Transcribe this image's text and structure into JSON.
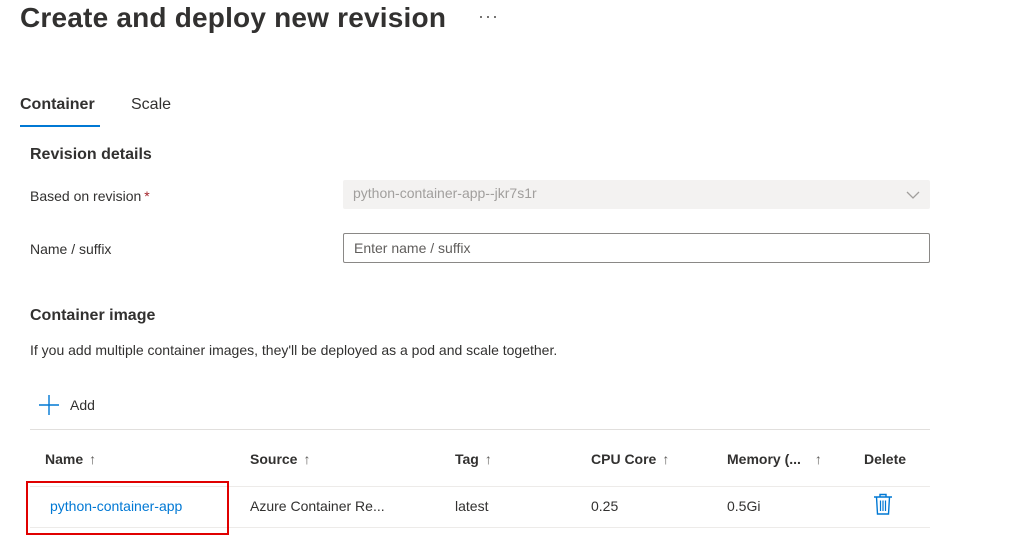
{
  "page": {
    "title": "Create and deploy new revision",
    "more_label": "···"
  },
  "tabs": [
    {
      "label": "Container",
      "selected": true
    },
    {
      "label": "Scale",
      "selected": false
    }
  ],
  "revision_details": {
    "heading": "Revision details",
    "based_on_label": "Based on revision",
    "required_marker": "*",
    "based_on_value": "python-container-app--jkr7s1r",
    "name_suffix_label": "Name / suffix",
    "name_suffix_value": "",
    "name_suffix_placeholder": "Enter name / suffix"
  },
  "container_image": {
    "heading": "Container image",
    "description": "If you add multiple container images, they'll be deployed as a pod and scale together.",
    "add_label": "Add",
    "table": {
      "columns": [
        {
          "label": "Name",
          "sort_arrow": "↑"
        },
        {
          "label": "Source",
          "sort_arrow": "↑"
        },
        {
          "label": "Tag",
          "sort_arrow": "↑"
        },
        {
          "label": "CPU Core",
          "sort_arrow": "↑"
        },
        {
          "label": "Memory (...",
          "sort_arrow": "↑"
        },
        {
          "label": "Delete",
          "sort_arrow": ""
        }
      ],
      "rows": [
        {
          "name": "python-container-app",
          "source": "Azure Container Re...",
          "tag": "latest",
          "cpu": "0.25",
          "memory": "0.5Gi",
          "delete_icon": "trash-icon"
        }
      ]
    }
  },
  "colors": {
    "accent": "#0078d4",
    "highlight": "#e00000",
    "text": "#323130",
    "disabled_bg": "#f3f2f1"
  }
}
